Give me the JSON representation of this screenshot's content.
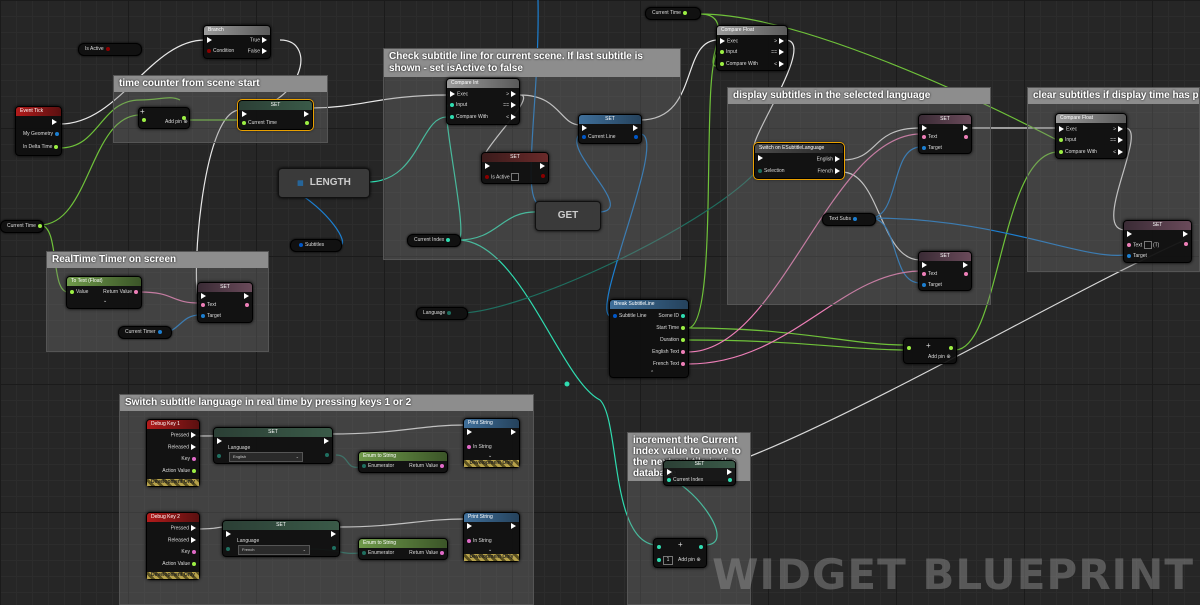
{
  "comments": {
    "time_counter": "time counter from scene start",
    "realtime_timer": "RealTime Timer on screen",
    "check_subtitle": "Check subtitle line for current scene. If last subtitle is shown - set isActive to false",
    "display_subtitles": "display subtitles in the selected language",
    "clear_subtitles": "clear subtitles if display time has passed",
    "switch_language": "Switch subtitle language in real time by pressing keys 1 or 2",
    "increment_index": "increment the Current Index value to move to the next subtile in the database"
  },
  "variables": {
    "is_active": "Is Active",
    "current_time_left": "Current Time",
    "current_time_top": "Current Time",
    "subtitles": "Subtitles",
    "current_index": "Current Index",
    "language": "Language",
    "current_timer": "Current Timer",
    "text_subs": "Text Subs"
  },
  "nodes": {
    "event_tick": {
      "title": "Event Tick",
      "pin_geometry": "My Geometry",
      "pin_delta": "In Delta Time"
    },
    "branch": {
      "title": "Branch",
      "pin_condition": "Condition",
      "pin_true": "True",
      "pin_false": "False"
    },
    "add_left": {
      "add_pin": "Add pin"
    },
    "set_time": {
      "title": "SET",
      "pin": "Current Time"
    },
    "to_text": {
      "title": "To Text (Float)",
      "pin_value": "Value",
      "pin_return": "Return Value"
    },
    "set_timer_text": {
      "title": "SET",
      "pin_text": "Text",
      "pin_target": "Target"
    },
    "length": {
      "title": "LENGTH"
    },
    "compare_int": {
      "title": "Compare Int",
      "pin_exec": "Exec",
      "pin_input": "Input",
      "pin_compare": "Compare With",
      "out_gt": ">",
      "out_eq": "==",
      "out_lt": "<"
    },
    "set_active": {
      "title": "SET",
      "pin": "Is Active"
    },
    "set_line": {
      "title": "SET",
      "pin": "Current Line"
    },
    "get": {
      "title": "GET"
    },
    "compare_float_top": {
      "title": "Compare Float",
      "pin_exec": "Exec",
      "pin_input": "Input",
      "pin_compare": "Compare With",
      "out_gt": ">",
      "out_eq": "==",
      "out_lt": "<"
    },
    "switch_lang": {
      "title": "Switch on ESubtitleLanguage",
      "pin_selection": "Selection",
      "out_english": "English",
      "out_french": "French"
    },
    "set_text_en": {
      "title": "SET",
      "pin_text": "Text",
      "pin_target": "Target"
    },
    "set_text_fr": {
      "title": "SET",
      "pin_text": "Text",
      "pin_target": "Target"
    },
    "break_line": {
      "title": "Break SubtitleLine",
      "pin_in": "Subtitle Line",
      "out_scene": "Scene ID",
      "out_start": "Start Time",
      "out_duration": "Duration",
      "out_english": "English Text",
      "out_french": "French Text"
    },
    "add_mid": {
      "add_pin": "Add pin"
    },
    "compare_float_right": {
      "title": "Compare Float",
      "pin_exec": "Exec",
      "pin_input": "Input",
      "pin_compare": "Compare With",
      "out_gt": ">",
      "out_eq": "==",
      "out_lt": "<"
    },
    "set_text_clear": {
      "title": "SET",
      "pin_text": "Text",
      "pin_target": "Target",
      "empty_label": "(T)"
    },
    "debug_key1": {
      "title": "Debug Key 1",
      "pressed": "Pressed",
      "released": "Released",
      "key": "Key",
      "action": "Action Value",
      "dev": "Development Only"
    },
    "debug_key2": {
      "title": "Debug Key 2",
      "pressed": "Pressed",
      "released": "Released",
      "key": "Key",
      "action": "Action Value",
      "dev": "Development Only"
    },
    "set_lang1": {
      "title": "SET",
      "pin": "Language",
      "value": "English"
    },
    "set_lang2": {
      "title": "SET",
      "pin": "Language",
      "value": "French"
    },
    "enum_to_string1": {
      "title": "Enum to String",
      "pin_in": "Enumerator",
      "pin_out": "Return Value"
    },
    "enum_to_string2": {
      "title": "Enum to String",
      "pin_in": "Enumerator",
      "pin_out": "Return Value"
    },
    "print_string1": {
      "title": "Print String",
      "pin": "In String",
      "dev": "Development Only"
    },
    "print_string2": {
      "title": "Print String",
      "pin": "In String",
      "dev": "Development Only"
    },
    "set_index": {
      "title": "SET",
      "pin": "Current Index"
    },
    "add_index": {
      "add_pin": "Add pin",
      "value": "1"
    }
  },
  "watermark": "WIDGET BLUEPRINT",
  "colors": {
    "exec": "#ffffff",
    "float": "#9cef43",
    "int": "#2fdcb0",
    "bool": "#8a0000",
    "text": "#ee7fb8",
    "object": "#1c7fd1",
    "struct": "#0057c8",
    "enum": "#004a40"
  }
}
